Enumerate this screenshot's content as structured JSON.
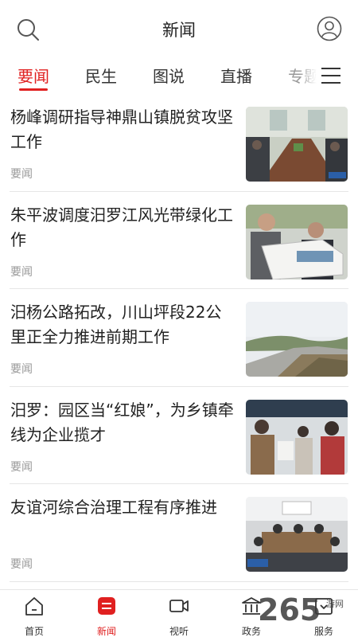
{
  "header": {
    "title": "新闻"
  },
  "tabs": [
    {
      "label": "要闻",
      "active": true
    },
    {
      "label": "民生"
    },
    {
      "label": "图说"
    },
    {
      "label": "直播"
    },
    {
      "label": "专题"
    }
  ],
  "news": [
    {
      "title": "杨峰调研指导神鼎山镇脱贫攻坚工作",
      "tag": "要闻"
    },
    {
      "title": "朱平波调度汨罗江风光带绿化工作",
      "tag": "要闻"
    },
    {
      "title": "汨杨公路拓改，川山坪段22公里正全力推进前期工作",
      "tag": "要闻"
    },
    {
      "title": "汨罗：园区当“红娘”，为乡镇牵线为企业揽才",
      "tag": "要闻"
    },
    {
      "title": "友谊河综合治理工程有序推进",
      "tag": "要闻"
    }
  ],
  "bottom_nav": [
    {
      "label": "首页",
      "icon": "home-icon"
    },
    {
      "label": "新闻",
      "icon": "news-icon",
      "active": true
    },
    {
      "label": "视听",
      "icon": "video-icon"
    },
    {
      "label": "政务",
      "icon": "government-icon"
    },
    {
      "label": "服务",
      "icon": "service-icon"
    }
  ],
  "watermark": {
    "main": "265",
    "side": "游网"
  },
  "colors": {
    "accent": "#e02020",
    "text": "#222222",
    "muted": "#999999"
  }
}
